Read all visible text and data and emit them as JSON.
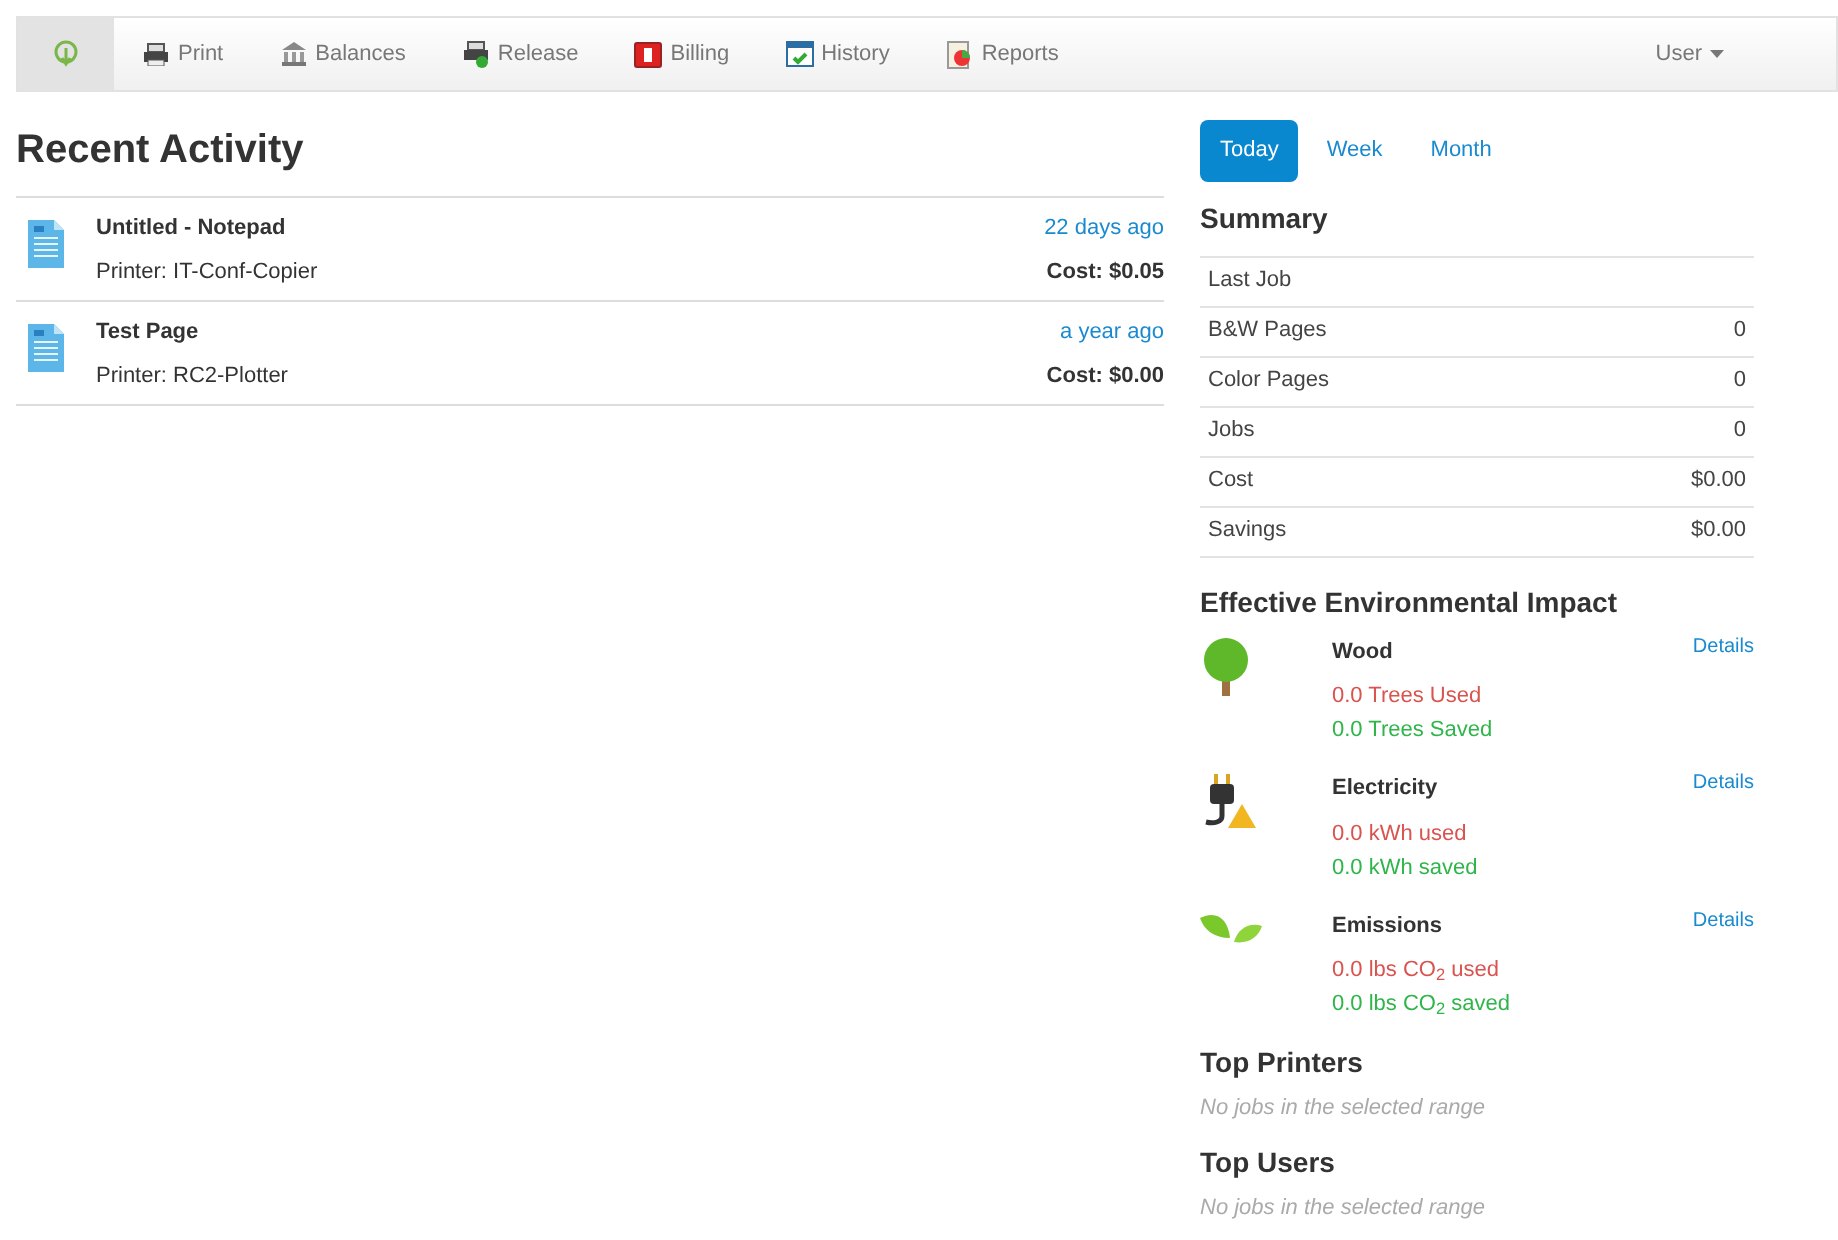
{
  "nav": {
    "items": [
      {
        "kind": "home",
        "selected": true
      },
      {
        "kind": "print",
        "label": "Print",
        "selected": false
      },
      {
        "kind": "balances",
        "label": "Balances",
        "selected": false
      },
      {
        "kind": "release",
        "label": "Release",
        "selected": false
      },
      {
        "kind": "billing",
        "label": "Billing",
        "selected": false
      },
      {
        "kind": "history",
        "label": "History",
        "selected": false
      },
      {
        "kind": "reports",
        "label": "Reports",
        "selected": false
      }
    ],
    "user": "User"
  },
  "recent_activity": {
    "title": "Recent Activity",
    "jobs": [
      {
        "name": "Untitled - Notepad",
        "printer": "Printer: IT-Conf-Copier",
        "time": "22 days ago",
        "cost": "Cost: $0.05"
      },
      {
        "name": "Test Page",
        "printer": "Printer: RC2-Plotter",
        "time": "a year ago",
        "cost": "Cost: $0.00"
      }
    ]
  },
  "range_tabs": [
    {
      "label": "Today",
      "selected": true
    },
    {
      "label": "Week",
      "selected": false
    },
    {
      "label": "Month",
      "selected": false
    }
  ],
  "summary": {
    "title": "Summary",
    "rows": [
      {
        "label": "Last Job"
      },
      {
        "label": "B&W Pages",
        "value": "0"
      },
      {
        "label": "Color Pages",
        "value": "0"
      },
      {
        "label": "Jobs",
        "value": "0"
      },
      {
        "label": "Cost",
        "value": "$0.00"
      },
      {
        "label": "Savings",
        "value": "$0.00"
      }
    ]
  },
  "impact": {
    "title": "Effective Environmental Impact",
    "items": [
      {
        "kind": "wood",
        "name": "Wood",
        "used": "0.0 Trees Used",
        "saved": "0.0 Trees Saved",
        "link": "Details"
      },
      {
        "kind": "electricity",
        "name": "Electricity",
        "used": "0.0 kWh used",
        "saved": "0.0 kWh saved",
        "link": "Details"
      },
      {
        "kind": "emissions",
        "name": "Emissions",
        "used": "0.0 lbs CO$_{2}$ used",
        "saved": "0.0 lbs CO$_{2}$ saved",
        "link": "Details"
      }
    ]
  },
  "top_printers": {
    "title": "Top Printers",
    "empty": "No jobs in the selected range"
  },
  "top_users": {
    "title": "Top Users",
    "empty": "No jobs in the selected range"
  }
}
